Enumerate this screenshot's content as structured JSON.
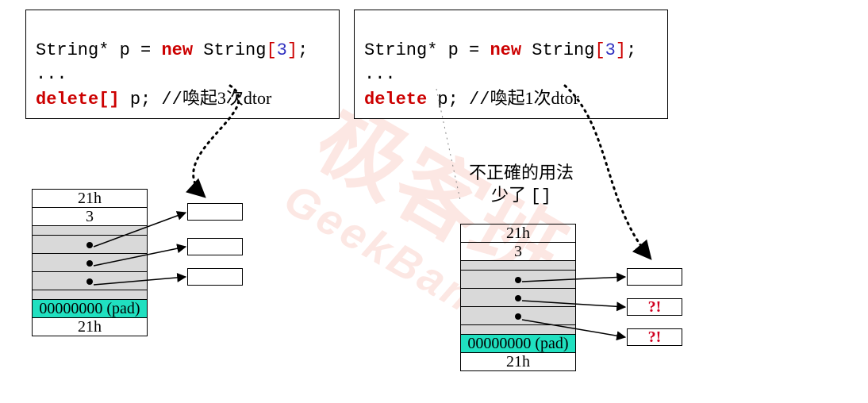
{
  "code_left": {
    "line1_pre": "String* p = ",
    "kw1": "new",
    "line1_mid": " String",
    "br_open": "[",
    "num": "3",
    "br_close": "]",
    "line1_end": ";",
    "line2": "...",
    "kw2": "delete[]",
    "line3_mid": " p; //",
    "line3_cn": "喚起3次dtor"
  },
  "code_right": {
    "line1_pre": "String* p = ",
    "kw1": "new",
    "line1_mid": " String",
    "br_open": "[",
    "num": "3",
    "br_close": "]",
    "line1_end": ";",
    "line2": "...",
    "kw2": "delete",
    "line3_mid": " p; //",
    "line3_cn": "喚起1次dtor"
  },
  "mem_left": {
    "r0": "21h",
    "r1": "3",
    "r5": "00000000 (pad)",
    "r6": "21h"
  },
  "mem_right": {
    "r0": "21h",
    "r1": "3",
    "r5": "00000000 (pad)",
    "r6": "21h"
  },
  "heap_right": {
    "q": "?!"
  },
  "caption": {
    "l1": "不正確的用法",
    "l2a": "少了 ",
    "l2b": "[]"
  },
  "chart_data": {
    "type": "diagram",
    "topic": "C++ delete[] vs delete on array allocation",
    "left": {
      "code": "String* p = new String[3]; ... delete[] p; // 喚起3次dtor",
      "memory_block": [
        "21h",
        "3",
        "ptr0",
        "ptr1",
        "ptr2",
        "00000000 (pad)",
        "21h"
      ],
      "pointer_targets": 3,
      "dtor_calls": 3,
      "correct": true
    },
    "right": {
      "code": "String* p = new String[3]; ... delete p; // 喚起1次dtor",
      "memory_block": [
        "21h",
        "3",
        "ptr0",
        "ptr1",
        "ptr2",
        "00000000 (pad)",
        "21h"
      ],
      "pointer_targets": 3,
      "dtor_calls": 1,
      "leaked_targets_label": "?!",
      "correct": false,
      "note": "不正確的用法 少了 []"
    }
  }
}
